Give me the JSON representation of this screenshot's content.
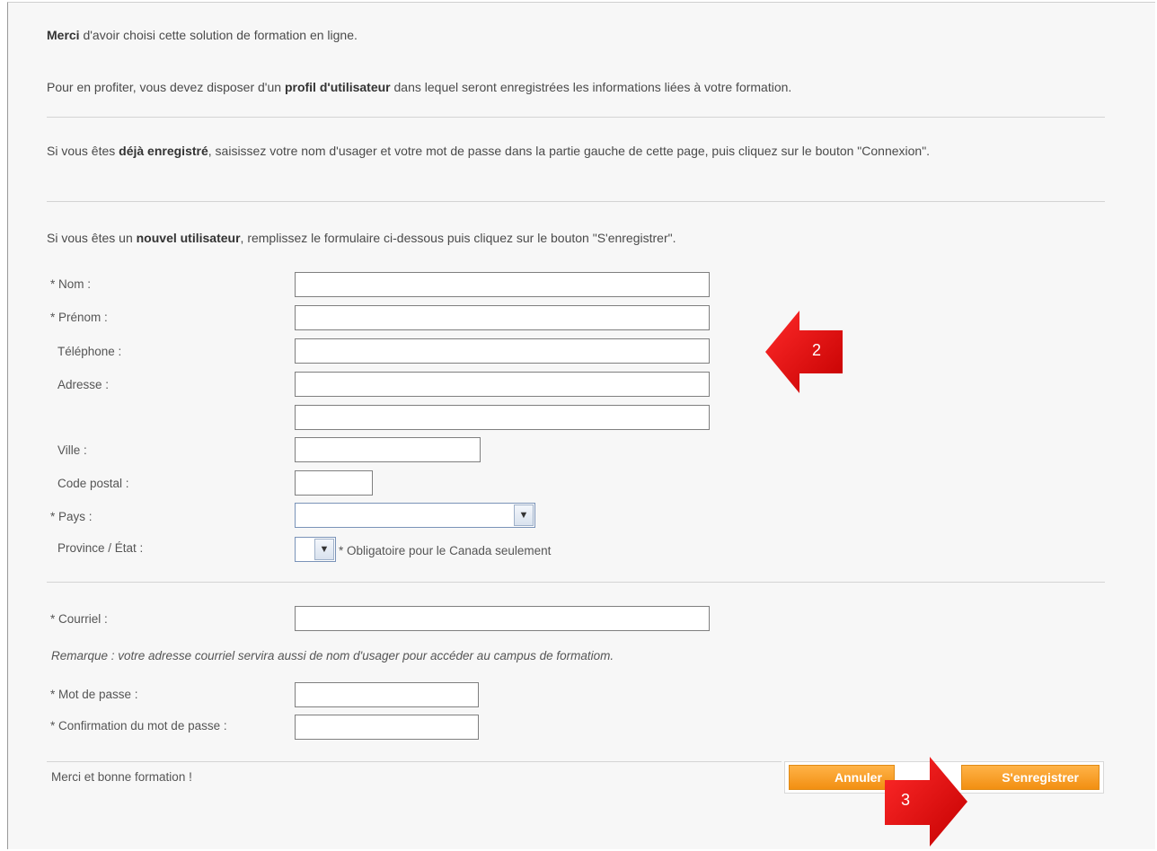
{
  "intro": {
    "merci_bold": "Merci",
    "merci_rest": " d'avoir choisi cette solution de formation en ligne.",
    "p2_a": "Pour en profiter, vous devez disposer d'un ",
    "p2_bold": "profil d'utilisateur",
    "p2_b": " dans lequel seront enregistrées les informations liées à votre formation.",
    "p3_a": "Si vous êtes ",
    "p3_bold": "déjà enregistré",
    "p3_b": ", saisissez votre nom d'usager et votre mot de passe dans la partie gauche de cette page, puis cliquez sur le bouton \"Connexion\".",
    "p4_a": "Si vous êtes un ",
    "p4_bold": "nouvel utilisateur",
    "p4_b": ", remplissez le formulaire ci-dessous puis cliquez sur le bouton \"S'enregistrer\"."
  },
  "form": {
    "nom_label": "* Nom :",
    "prenom_label": "* Prénom :",
    "telephone_label": "Téléphone :",
    "adresse_label": "Adresse :",
    "ville_label": "Ville :",
    "code_postal_label": "Code postal :",
    "pays_label": "* Pays :",
    "province_label": "Province / État :",
    "province_note": "* Obligatoire pour le Canada seulement",
    "courriel_label": "* Courriel :",
    "remarque": "Remarque : votre adresse courriel servira aussi de nom d'usager pour accéder au campus de formatiom.",
    "mot_de_passe_label": "* Mot de passe :",
    "confirmation_label": "* Confirmation du mot de passe :"
  },
  "footer": {
    "closing": "Merci et bonne formation !",
    "cancel_label": "Annuler",
    "register_label": "S'enregistrer"
  },
  "annotations": {
    "arrow_2": "2",
    "arrow_3": "3",
    "color": "#e60000"
  },
  "colors": {
    "button_orange": "#f7a128",
    "background": "#f7f7f7"
  }
}
